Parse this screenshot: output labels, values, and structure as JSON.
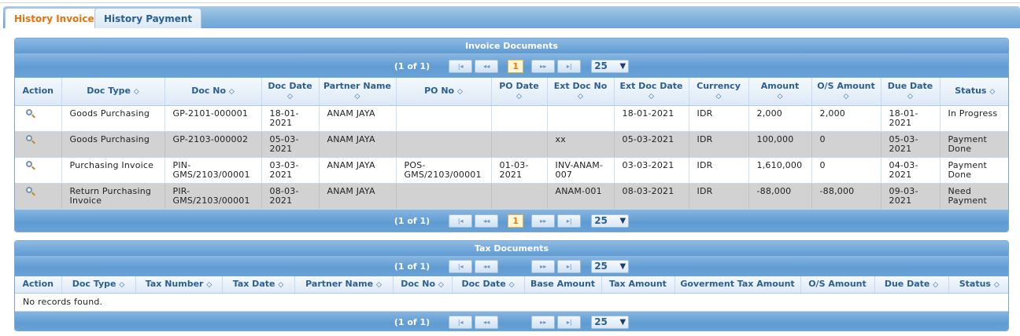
{
  "tabs": [
    {
      "label": "History Invoice",
      "active": true
    },
    {
      "label": "History Payment",
      "active": false
    }
  ],
  "invoice": {
    "title": "Invoice Documents",
    "pager": {
      "current_text": "(1 of 1)",
      "page": "1",
      "rows_per_page": "25"
    },
    "columns": [
      "Action",
      "Doc Type",
      "Doc No",
      "Doc Date",
      "Partner Name",
      "PO No",
      "PO Date",
      "Ext Doc No",
      "Ext Doc Date",
      "Currency",
      "Amount",
      "O/S Amount",
      "Due Date",
      "Status"
    ],
    "rows": [
      {
        "doc_type": "Goods Purchasing",
        "doc_no": "GP-2101-000001",
        "doc_date": "18-01-2021",
        "partner": "ANAM JAYA",
        "po_no": "",
        "po_date": "",
        "ext_doc_no": "",
        "ext_doc_date": "18-01-2021",
        "currency": "IDR",
        "amount": "2,000",
        "os_amount": "2,000",
        "due_date": "18-01-2021",
        "status": "In Progress"
      },
      {
        "doc_type": "Goods Purchasing",
        "doc_no": "GP-2103-000002",
        "doc_date": "05-03-2021",
        "partner": "ANAM JAYA",
        "po_no": "",
        "po_date": "",
        "ext_doc_no": "xx",
        "ext_doc_date": "05-03-2021",
        "currency": "IDR",
        "amount": "100,000",
        "os_amount": "0",
        "due_date": "05-03-2021",
        "status": "Payment Done"
      },
      {
        "doc_type": "Purchasing Invoice",
        "doc_no": "PIN-GMS/2103/00001",
        "doc_date": "03-03-2021",
        "partner": "ANAM JAYA",
        "po_no": "POS-GMS/2103/00001",
        "po_date": "01-03-2021",
        "ext_doc_no": "INV-ANAM-007",
        "ext_doc_date": "03-03-2021",
        "currency": "IDR",
        "amount": "1,610,000",
        "os_amount": "0",
        "due_date": "04-03-2021",
        "status": "Payment Done"
      },
      {
        "doc_type": "Return Purchasing Invoice",
        "doc_no": "PIR-GMS/2103/00001",
        "doc_date": "08-03-2021",
        "partner": "ANAM JAYA",
        "po_no": "",
        "po_date": "",
        "ext_doc_no": "ANAM-001",
        "ext_doc_date": "08-03-2021",
        "currency": "IDR",
        "amount": "-88,000",
        "os_amount": "-88,000",
        "due_date": "09-03-2021",
        "status": "Need Payment"
      }
    ]
  },
  "tax": {
    "title": "Tax Documents",
    "pager": {
      "current_text": "(1 of 1)",
      "rows_per_page": "25"
    },
    "columns": [
      "Action",
      "Doc Type",
      "Tax Number",
      "Tax Date",
      "Partner Name",
      "Doc No",
      "Doc Date",
      "Base Amount",
      "Tax Amount",
      "Goverment Tax Amount",
      "O/S Amount",
      "Due Date",
      "Status"
    ],
    "empty_message": "No records found."
  },
  "icons": {
    "view": "magnifier-icon",
    "sort": "sort-icon",
    "first": "first-page-icon",
    "prev": "prev-page-icon",
    "next": "next-page-icon",
    "last": "last-page-icon",
    "dropdown": "chevron-down-icon"
  },
  "colors": {
    "accent_tab": "#e5730c",
    "header_blue": "#5f9bd2",
    "header_text": "#2a5f94"
  }
}
